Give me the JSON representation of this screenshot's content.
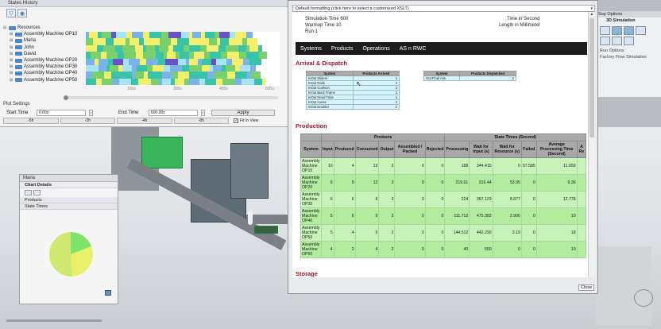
{
  "states_history": {
    "title": "States History",
    "tree": [
      {
        "label": "Resources",
        "level": 0
      },
      {
        "label": "Assembly Machine OP10",
        "level": 1
      },
      {
        "label": "Maria",
        "level": 1
      },
      {
        "label": "John",
        "level": 1
      },
      {
        "label": "David",
        "level": 1
      },
      {
        "label": "Assembly Machine OP20",
        "level": 1
      },
      {
        "label": "Assembly Machine OP30",
        "level": 1
      },
      {
        "label": "Assembly Machine OP40",
        "level": 1
      },
      {
        "label": "Assembly Machine OP50",
        "level": 1
      }
    ],
    "ticks": [
      "150s",
      "300s",
      "450s",
      "600s"
    ],
    "state_colors": {
      "working": "#37c4a8",
      "idle": "#f3ee6c",
      "blocked": "#79d06c",
      "setup": "#7bb3e8",
      "failed": "#6a52c6",
      "other": "#a6e3f5"
    },
    "plot_settings": {
      "title": "Plot Settings",
      "start_label": "Start Time",
      "start_value": "0.00s",
      "end_label": "End Time",
      "end_value": "600.00s",
      "apply_label": "Apply",
      "shift_buttons": [
        "-5h",
        "-2h",
        "-4h",
        "-8h"
      ],
      "fit_label": "Fit In View"
    }
  },
  "maria_panel": {
    "title": "Maria",
    "sections": [
      "Chart Details",
      "Products",
      "State Times"
    ],
    "pie_colors": [
      "#7de36b",
      "#e8f06a",
      "#cfe870"
    ]
  },
  "sim_options": {
    "title": "Sup Options",
    "subtitle": "3D Simulation",
    "lines": [
      "Run Options",
      "Factory Flow Simulation"
    ]
  },
  "report": {
    "format_bar": "Default formatting (click here to select a customized XSLT)",
    "header": {
      "sim_time": "Simulation Time 600",
      "warmup": "Warmup Time 10",
      "run": "Run 1",
      "time_unit": "Time in Second",
      "length_unit": "Length in Millimeter"
    },
    "nav": [
      "Systems",
      "Products",
      "Operations",
      "AS n RWC"
    ],
    "arrival_title": "Arrival & Dispatch",
    "arrival_table": {
      "headers": [
        "System",
        "Products Arrived"
      ],
      "rows": [
        [
          "InOut Sliders",
          "4"
        ],
        [
          "InOut Rails",
          "4"
        ],
        [
          "InOut Cushion",
          "3"
        ],
        [
          "InOut Back Frame",
          "3"
        ],
        [
          "InOut Head Tube",
          "4"
        ],
        [
          "InOut Axese",
          "4"
        ],
        [
          "InOut Doubler",
          "2"
        ]
      ]
    },
    "dispatch_table": {
      "headers": [
        "System",
        "Products Dispatched"
      ],
      "rows": [
        [
          "Out Final Ass",
          "2"
        ]
      ]
    },
    "production_title": "Production",
    "production_table": {
      "group_headers": [
        "Products",
        "State Times (Second)"
      ],
      "headers": [
        "System",
        "Input",
        "Produced",
        "Consumed",
        "Output",
        "Assembled / Packed",
        "Rejected",
        "Processing",
        "Wait for Input (s)",
        "Wait for Resource (s)",
        "Failed",
        "Average Processing Time (Second)",
        "A Re"
      ],
      "rows": [
        [
          "Assembly Machine OP10",
          "10",
          "4",
          "12",
          "3",
          "0",
          "0",
          "188",
          "344.415",
          "0",
          "57.585",
          "11.059",
          ""
        ],
        [
          "Assembly Machine OP20",
          "6",
          "9",
          "12",
          "3",
          "0",
          "0",
          "219.61",
          "316.44",
          "53.95",
          "0",
          "9.36",
          ""
        ],
        [
          "Assembly Machine OP30",
          "6",
          "6",
          "9",
          "3",
          "0",
          "0",
          "224",
          "357.123",
          "8.877",
          "0",
          "12.778",
          ""
        ],
        [
          "Assembly Machine OP40",
          "5",
          "6",
          "9",
          "3",
          "0",
          "0",
          "111.712",
          "475.382",
          "2.906",
          "0",
          "10",
          ""
        ],
        [
          "Assembly Machine OP50",
          "5",
          "4",
          "6",
          "2",
          "0",
          "0",
          "144.512",
          "442.299",
          "3.19",
          "0",
          "18",
          ""
        ],
        [
          "Assembly Machine OP60",
          "4",
          "2",
          "4",
          "2",
          "0",
          "0",
          "40",
          "550",
          "0",
          "0",
          "10",
          ""
        ]
      ]
    },
    "storage_title": "Storage",
    "close_label": "Close"
  }
}
